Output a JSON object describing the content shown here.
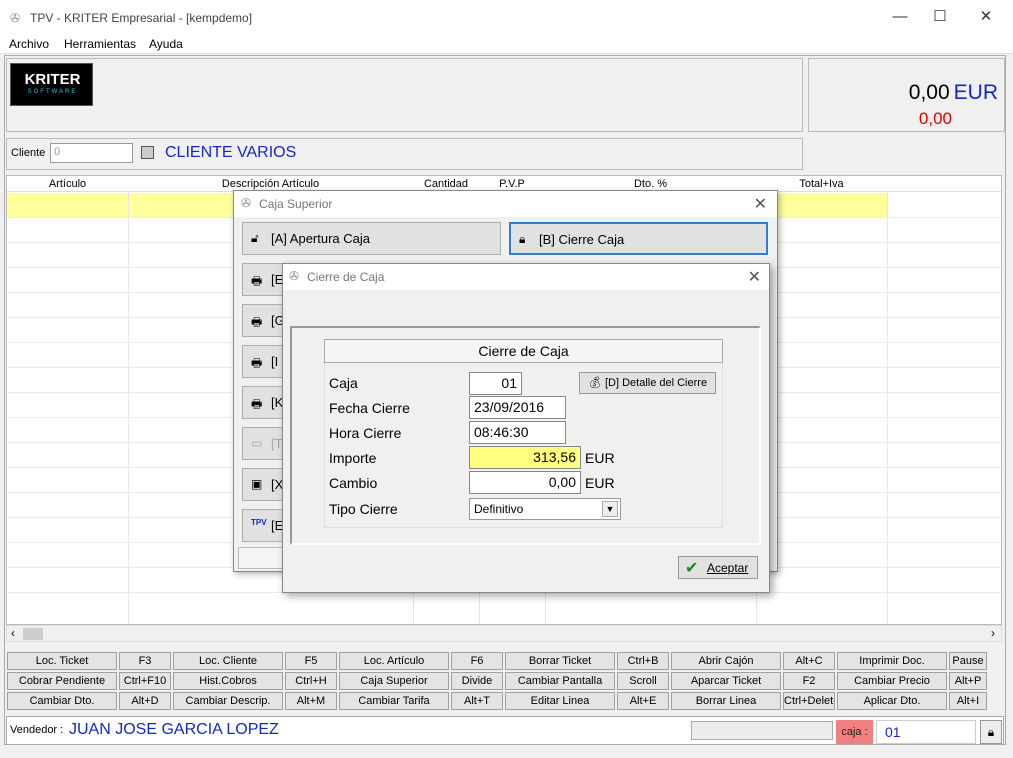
{
  "window": {
    "title": "TPV - KRITER Empresarial -  [kempdemo]",
    "icon": "app-icon"
  },
  "menu": [
    "Archivo",
    "Herramientas",
    "Ayuda"
  ],
  "logo": {
    "line1": "KRITER",
    "line2": "SOFTWARE"
  },
  "totals": {
    "amount": "0,00",
    "currency": "EUR",
    "secondary": "0,00"
  },
  "client": {
    "label": "Cliente",
    "value": "0",
    "name": "CLIENTE VARIOS"
  },
  "grid": {
    "headers": [
      "Artículo",
      "Descripción Artículo",
      "Cantidad",
      "P.V.P",
      "Dto. %",
      "Total+Iva"
    ]
  },
  "shortcuts": [
    [
      "Loc. Ticket",
      "F3",
      "Loc. Cliente",
      "F5",
      "Loc. Artículo",
      "F6",
      "Borrar Ticket",
      "Ctrl+B",
      "Abrir Cajón",
      "Alt+C",
      "Imprimir Doc.",
      "Pause"
    ],
    [
      "Cobrar Pendiente",
      "Ctrl+F10",
      "Hist.Cobros",
      "Ctrl+H",
      "Caja Superior",
      "Divide",
      "Cambiar Pantalla",
      "Scroll",
      "Aparcar Ticket",
      "F2",
      "Cambiar Precio",
      "Alt+P"
    ],
    [
      "Cambiar Dto.",
      "Alt+D",
      "Cambiar Descrip.",
      "Alt+M",
      "Cambiar Tarifa",
      "Alt+T",
      "Editar Linea",
      "Alt+E",
      "Borrar Linea",
      "Ctrl+Delete",
      "Aplicar Dto.",
      "Alt+I"
    ]
  ],
  "vendor": {
    "label": "Vendedor :",
    "name": "JUAN JOSE GARCIA LOPEZ",
    "caja_label": "caja :",
    "caja": "01"
  },
  "dialog_caja": {
    "title": "Caja Superior",
    "apertura": "[A] Apertura Caja",
    "cierre": "[B] Cierre Caja",
    "partial": [
      "[E",
      "[G",
      "[I",
      "[K",
      "[T",
      "[X",
      "[E"
    ]
  },
  "dialog_cierre": {
    "title": "Cierre de Caja",
    "header": "Cierre de Caja",
    "caja_label": "Caja",
    "caja": "01",
    "detalle_btn": "[D] Detalle del Cierre",
    "fecha_label": "Fecha Cierre",
    "fecha": "23/09/2016",
    "hora_label": "Hora Cierre",
    "hora": "08:46:30",
    "importe_label": "Importe",
    "importe": "313,56",
    "importe_cur": "EUR",
    "cambio_label": "Cambio",
    "cambio": "0,00",
    "cambio_cur": "EUR",
    "tipo_label": "Tipo Cierre",
    "tipo": "Definitivo",
    "aceptar": "Aceptar"
  },
  "colors": {
    "accent_blue": "#1428c8",
    "total_red": "#e00000",
    "highlight_yellow": "#ffff9c"
  }
}
